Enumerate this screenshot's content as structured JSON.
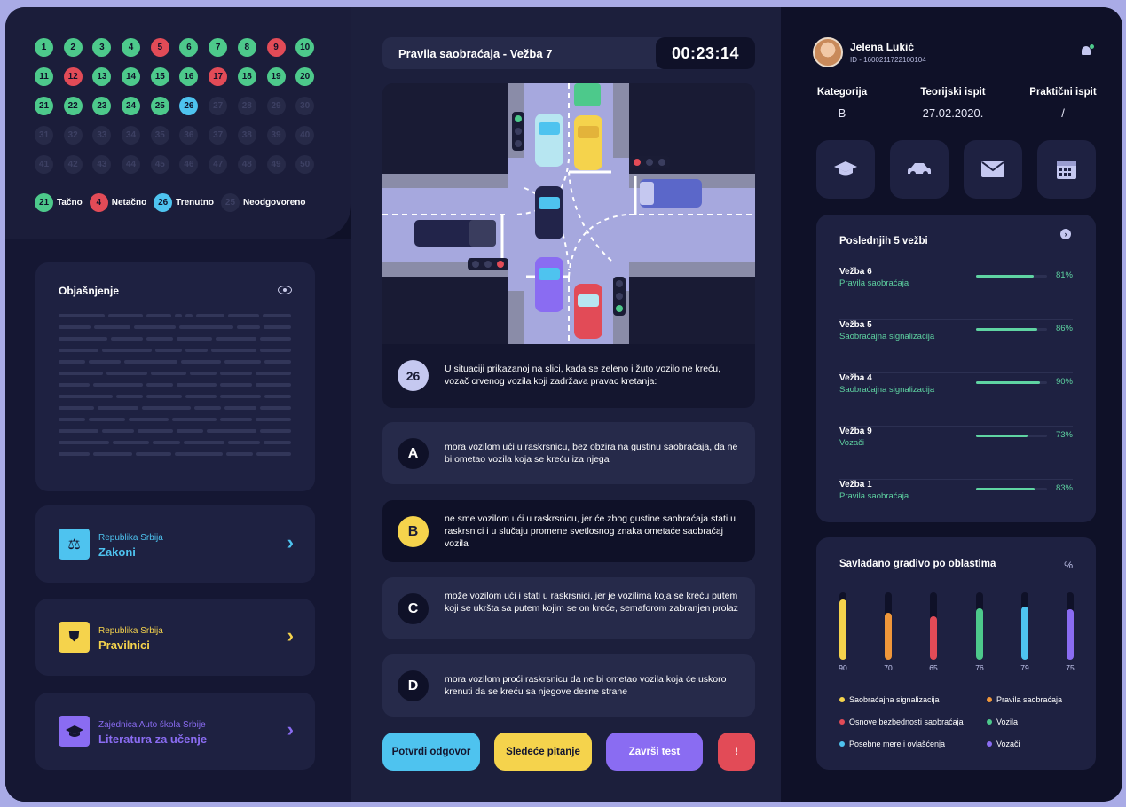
{
  "questions": [
    {
      "n": "1",
      "s": "green"
    },
    {
      "n": "2",
      "s": "green"
    },
    {
      "n": "3",
      "s": "green"
    },
    {
      "n": "4",
      "s": "green"
    },
    {
      "n": "5",
      "s": "red"
    },
    {
      "n": "6",
      "s": "green"
    },
    {
      "n": "7",
      "s": "green"
    },
    {
      "n": "8",
      "s": "green"
    },
    {
      "n": "9",
      "s": "red"
    },
    {
      "n": "10",
      "s": "green"
    },
    {
      "n": "11",
      "s": "green"
    },
    {
      "n": "12",
      "s": "red"
    },
    {
      "n": "13",
      "s": "green"
    },
    {
      "n": "14",
      "s": "green"
    },
    {
      "n": "15",
      "s": "green"
    },
    {
      "n": "16",
      "s": "green"
    },
    {
      "n": "17",
      "s": "red"
    },
    {
      "n": "18",
      "s": "green"
    },
    {
      "n": "19",
      "s": "green"
    },
    {
      "n": "20",
      "s": "green"
    },
    {
      "n": "21",
      "s": "green"
    },
    {
      "n": "22",
      "s": "green"
    },
    {
      "n": "23",
      "s": "green"
    },
    {
      "n": "24",
      "s": "green"
    },
    {
      "n": "25",
      "s": "green"
    },
    {
      "n": "26",
      "s": "cur"
    },
    {
      "n": "27",
      "s": "none"
    },
    {
      "n": "28",
      "s": "none"
    },
    {
      "n": "29",
      "s": "none"
    },
    {
      "n": "30",
      "s": "none"
    },
    {
      "n": "31",
      "s": "none"
    },
    {
      "n": "32",
      "s": "none"
    },
    {
      "n": "33",
      "s": "none"
    },
    {
      "n": "34",
      "s": "none"
    },
    {
      "n": "35",
      "s": "none"
    },
    {
      "n": "36",
      "s": "none"
    },
    {
      "n": "37",
      "s": "none"
    },
    {
      "n": "38",
      "s": "none"
    },
    {
      "n": "39",
      "s": "none"
    },
    {
      "n": "40",
      "s": "none"
    },
    {
      "n": "41",
      "s": "none"
    },
    {
      "n": "42",
      "s": "none"
    },
    {
      "n": "43",
      "s": "none"
    },
    {
      "n": "44",
      "s": "none"
    },
    {
      "n": "45",
      "s": "none"
    },
    {
      "n": "46",
      "s": "none"
    },
    {
      "n": "47",
      "s": "none"
    },
    {
      "n": "48",
      "s": "none"
    },
    {
      "n": "49",
      "s": "none"
    },
    {
      "n": "50",
      "s": "none"
    }
  ],
  "legend": [
    {
      "num": "21",
      "label": "Tačno",
      "s": "green"
    },
    {
      "num": "4",
      "label": "Netačno",
      "s": "red"
    },
    {
      "num": "26",
      "label": "Trenutno",
      "s": "cur"
    },
    {
      "num": "25",
      "label": "Neodgovoreno",
      "s": "none"
    }
  ],
  "explanation": {
    "title": "Objašnjenje",
    "icon": "eye-icon"
  },
  "links": [
    {
      "sub": "Republika Srbija",
      "title": "Zakoni",
      "icon": "scales-icon",
      "glyph": "⚖",
      "color": "#4ec3ef"
    },
    {
      "sub": "Republika Srbija",
      "title": "Pravilnici",
      "icon": "shield-icon",
      "glyph": "⛊",
      "color": "#f5d34c"
    },
    {
      "sub": "Zajednica Auto škola Srbije",
      "title": "Literatura za učenje",
      "icon": "graduation-cap-icon",
      "glyph": "🎓",
      "color": "#8a6cf2"
    }
  ],
  "test": {
    "title": "Pravila saobraćaja - Vežba 7",
    "timer": "00:23:14"
  },
  "question": {
    "number": "26",
    "text": "U situaciji prikazanoj na slici, kada se zeleno i žuto vozilo ne kreću, vozač crvenog vozila koji zadržava pravac kretanja:"
  },
  "answers": [
    {
      "letter": "A",
      "text": "mora vozilom ući u raskrsnicu, bez obzira na gustinu saobraćaja, da ne bi ometao vozila koja se kreću iza njega"
    },
    {
      "letter": "B",
      "text": "ne sme vozilom ući u raskrsnicu, jer će zbog gustine saobraćaja stati u raskrsnici i u slučaju promene svetlosnog znaka ometaće saobraćaj vozila"
    },
    {
      "letter": "C",
      "text": "može vozilom ući i stati u raskrsnici, jer je vozilima koja se kreću putem koji se ukršta sa putem kojim se on kreće, semaforom zabranjen prolaz"
    },
    {
      "letter": "D",
      "text": "mora vozilom proći raskrsnicu da ne bi ometao vozila koja će uskoro krenuti da se kreću sa njegove desne strane"
    }
  ],
  "buttons": {
    "confirm": "Potvrdi odgovor",
    "next": "Sledeće pitanje",
    "finish": "Završi test",
    "report": "!"
  },
  "user": {
    "name": "Jelena Lukić",
    "id": "ID - 1600211722100104"
  },
  "info": {
    "category_label": "Kategorija",
    "category": "B",
    "theory_label": "Teorijski ispit",
    "theory": "27.02.2020.",
    "practical_label": "Praktični ispit",
    "practical": "/"
  },
  "icon_tiles": [
    "graduation-cap-icon",
    "car-icon",
    "mail-icon",
    "calendar-icon"
  ],
  "last5": {
    "title": "Poslednjih 5 vežbi",
    "items": [
      {
        "name": "Vežba 6",
        "sub": "Pravila saobraćaja",
        "pct": "81%",
        "value": 81
      },
      {
        "name": "Vežba 5",
        "sub": "Saobraćajna signalizacija",
        "pct": "86%",
        "value": 86
      },
      {
        "name": "Vežba 4",
        "sub": "Saobraćajna signalizacija",
        "pct": "90%",
        "value": 90
      },
      {
        "name": "Vežba 9",
        "sub": "Vozači",
        "pct": "73%",
        "value": 73
      },
      {
        "name": "Vežba 1",
        "sub": "Pravila saobraćaja",
        "pct": "83%",
        "value": 83
      }
    ]
  },
  "mastery": {
    "title": "Savladano gradivo po oblastima",
    "unit": "%",
    "bars": [
      {
        "value": 90,
        "label": "90",
        "color": "#f5d34c"
      },
      {
        "value": 70,
        "label": "70",
        "color": "#f0973a"
      },
      {
        "value": 65,
        "label": "65",
        "color": "#e24b57"
      },
      {
        "value": 76,
        "label": "76",
        "color": "#4dc98b"
      },
      {
        "value": 79,
        "label": "79",
        "color": "#4ec3ef"
      },
      {
        "value": 75,
        "label": "75",
        "color": "#8a6cf2"
      }
    ],
    "legend": [
      {
        "label": "Saobraćajna signalizacija",
        "color": "#f5d34c"
      },
      {
        "label": "Pravila saobraćaja",
        "color": "#f0973a"
      },
      {
        "label": "Osnove bezbednosti saobraćaja",
        "color": "#e24b57"
      },
      {
        "label": "Vozila",
        "color": "#4dc98b"
      },
      {
        "label": "Posebne mere i ovlašćenja",
        "color": "#4ec3ef"
      },
      {
        "label": "Vozači",
        "color": "#8a6cf2"
      }
    ]
  }
}
